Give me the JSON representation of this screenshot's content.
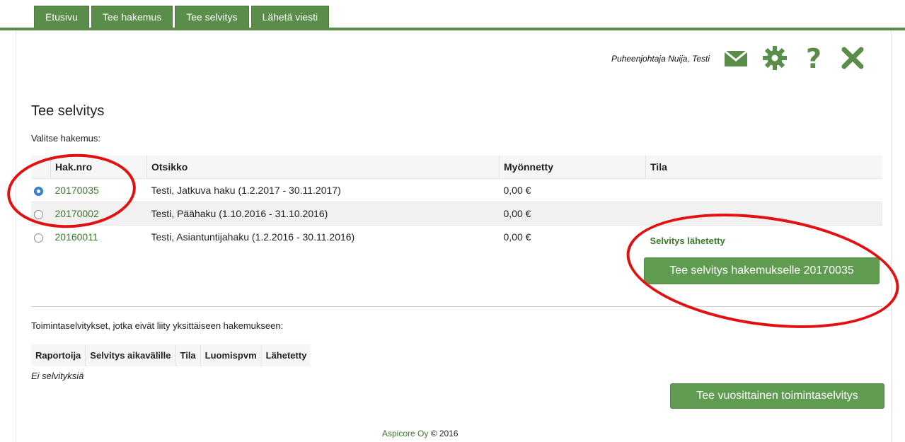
{
  "tabs": [
    {
      "label": "Etusivu"
    },
    {
      "label": "Tee hakemus"
    },
    {
      "label": "Tee selvitys"
    },
    {
      "label": "Lähetä viesti"
    }
  ],
  "header": {
    "user": "Puheenjohtaja Nuija, Testi",
    "icons": [
      "mail-icon",
      "gear-icon",
      "help-icon",
      "close-icon"
    ],
    "accent": "#5b8d4a"
  },
  "page": {
    "title": "Tee selvitys",
    "select_label": "Valitse hakemus:"
  },
  "applications": {
    "columns": [
      "Hak.nro",
      "Otsikko",
      "Myönnetty",
      "Tila"
    ],
    "rows": [
      {
        "selected": true,
        "number": "20170035",
        "title": "Testi, Jatkuva haku (1.2.2017 - 30.11.2017)",
        "granted": "0,00 €",
        "status": ""
      },
      {
        "selected": false,
        "number": "20170002",
        "title": "Testi, Päähaku (1.10.2016 - 31.10.2016)",
        "granted": "0,00 €",
        "status": ""
      },
      {
        "selected": false,
        "number": "20160011",
        "title": "Testi, Asiantuntijahaku (1.2.2016 - 30.11.2016)",
        "granted": "0,00 €",
        "status": "Selvitys lähetetty"
      }
    ]
  },
  "make_report_button": "Tee selvitys hakemukselle 20170035",
  "reports": {
    "label": "Toimintaselvitykset, jotka eivät liity yksittäiseen hakemukseen:",
    "columns": [
      "Raportoija",
      "Selvitys aikavälille",
      "Tila",
      "Luomispvm",
      "Lähetetty"
    ],
    "empty": "Ei selvityksiä"
  },
  "yearly_button": "Tee vuosittainen toimintaselvitys",
  "footer": {
    "brand": "Aspicore Oy",
    "rest": "© 2016"
  },
  "annotation_color": "#e41010"
}
